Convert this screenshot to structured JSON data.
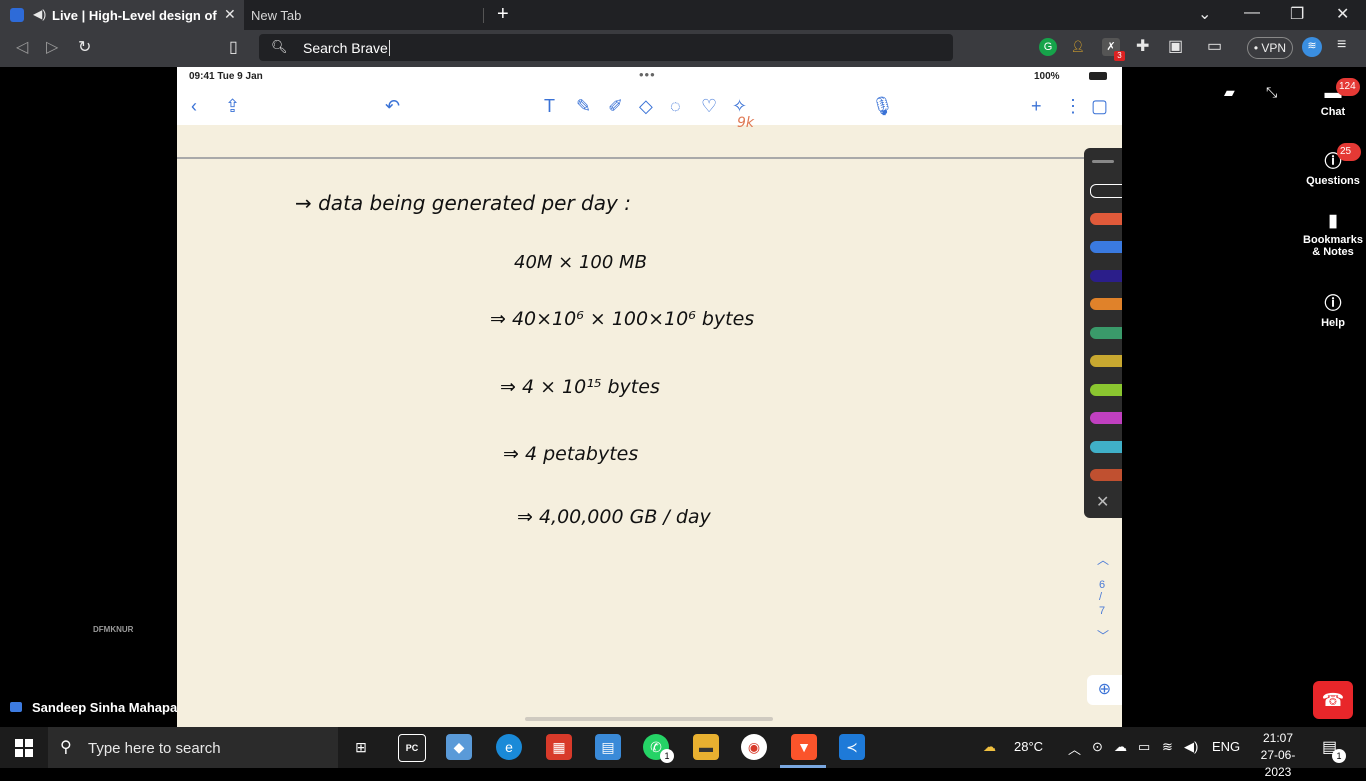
{
  "browser": {
    "tabs": [
      {
        "label": "Live | High-Level design of You",
        "active": true
      },
      {
        "label": "New Tab",
        "active": false
      }
    ],
    "new_tab_label": "+",
    "search_placeholder": "Search Brave",
    "vpn_label": "• VPN",
    "ext_badge_count": "3",
    "window_controls": {
      "minimize": "—",
      "maximize": "❐",
      "close": "✕"
    }
  },
  "ipad": {
    "status_time": "09:41  Tue 9 Jan",
    "status_dots": "•••",
    "battery": "100%",
    "page_indicator": {
      "current": "6",
      "separator": "/",
      "total": "7"
    }
  },
  "notes": {
    "top_red_scribble": "9k",
    "lines": [
      "→  data  being  generated  per day :",
      "40M  ×    100 MB",
      "⇒  40×10⁶   ×     100×10⁶  bytes",
      "⇒   4 × 10¹⁵  bytes",
      "⇒   4   petabytes",
      "⇒  4,00,000  GB / day"
    ]
  },
  "pen_colors": [
    "#2a2a2a",
    "#e05a3a",
    "#3a7ae0",
    "#2b1e8a",
    "#e0822a",
    "#3a9a6a",
    "#c8a830",
    "#8ac630",
    "#c040c0",
    "#40b0c8",
    "#c05030"
  ],
  "meeting": {
    "watermark": "DFMKNUR",
    "presenter": "Sandeep Sinha Mahapatra (Screen)",
    "side_panel": [
      {
        "label": "Chat",
        "badge": "124"
      },
      {
        "label": "Questions",
        "badge": "25"
      },
      {
        "label": "Bookmarks & Notes",
        "badge": ""
      },
      {
        "label": "Help",
        "badge": ""
      }
    ]
  },
  "taskbar": {
    "search_placeholder": "Type here to search",
    "whatsapp_badge": "1",
    "weather": "28°C",
    "language": "ENG",
    "time": "21:07",
    "date": "27-06-2023",
    "notification_count": "1"
  }
}
